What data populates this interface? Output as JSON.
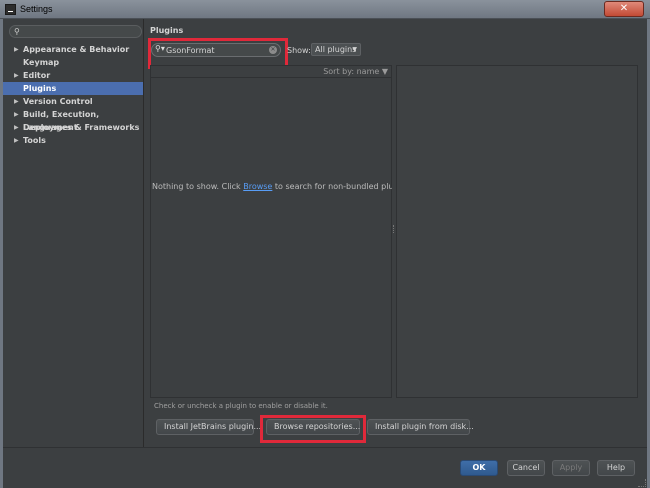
{
  "window": {
    "title": "Settings",
    "close_glyph": "✕"
  },
  "sidebar": {
    "search_placeholder": "",
    "items": [
      {
        "label": "Appearance & Behavior",
        "expandable": true,
        "selected": false
      },
      {
        "label": "Keymap",
        "expandable": false,
        "selected": false
      },
      {
        "label": "Editor",
        "expandable": true,
        "selected": false
      },
      {
        "label": "Plugins",
        "expandable": false,
        "selected": true
      },
      {
        "label": "Version Control",
        "expandable": true,
        "selected": false
      },
      {
        "label": "Build, Execution, Deployment",
        "expandable": true,
        "selected": false
      },
      {
        "label": "Languages & Frameworks",
        "expandable": true,
        "selected": false
      },
      {
        "label": "Tools",
        "expandable": true,
        "selected": false
      }
    ]
  },
  "plugins": {
    "title": "Plugins",
    "search_value": "GsonFormat",
    "show_label": "Show:",
    "show_value": "All plugins",
    "sort_label": "Sort by: name",
    "empty_prefix": "Nothing to show. Click ",
    "empty_link": "Browse",
    "empty_suffix": " to search for non-bundled plugins",
    "hint": "Check or uncheck a plugin to enable or disable it.",
    "install_jetbrains": "Install JetBrains plugin...",
    "browse_repos": "Browse repositories...",
    "install_disk": "Install plugin from disk..."
  },
  "footer": {
    "ok": "OK",
    "cancel": "Cancel",
    "apply": "Apply",
    "help": "Help"
  },
  "colors": {
    "highlight": "#e0293a",
    "selection": "#4b6eaf",
    "link": "#589df6"
  },
  "icons": [
    "app-icon",
    "search-icon",
    "clear-icon",
    "expand-arrow-icon",
    "caret-down-icon"
  ]
}
